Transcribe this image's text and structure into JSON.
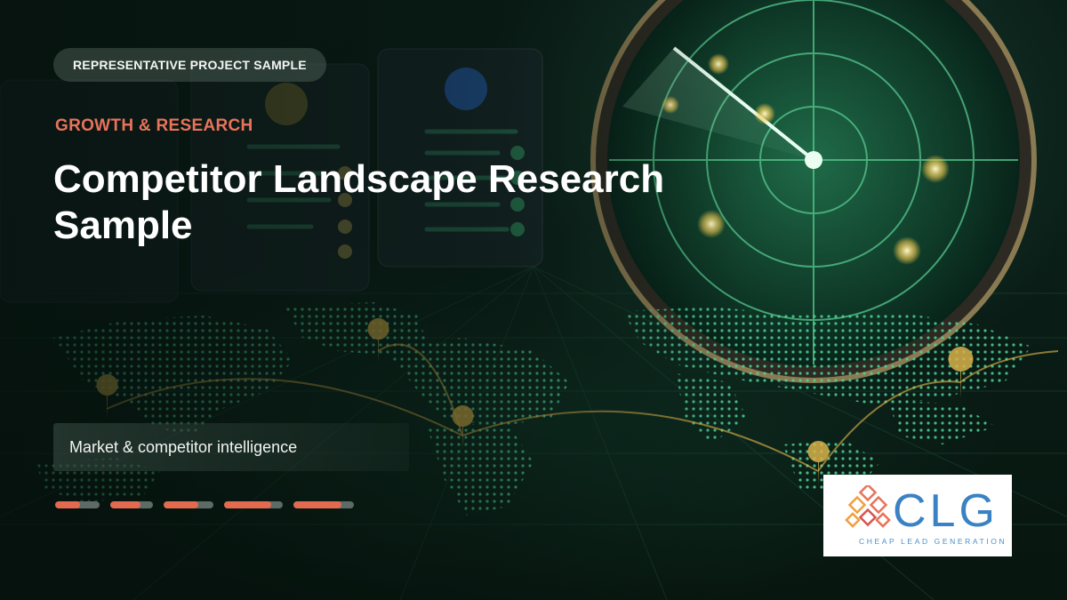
{
  "slide": {
    "tag": "REPRESENTATIVE PROJECT SAMPLE",
    "category": "GROWTH & RESEARCH",
    "title": "Competitor Landscape Research Sample",
    "subtitle": "Market & competitor intelligence"
  },
  "progress_indicators": [
    0.55,
    0.7,
    0.7,
    0.8,
    0.8
  ],
  "brand": {
    "logo_text": "CLG",
    "tagline": "CHEAP LEAD GENERATION"
  },
  "colors": {
    "accent": "#e36a4f",
    "background": "#0a1d17",
    "radar": "#3fbf7f",
    "logo_blue": "#3a82c4"
  },
  "icons": [
    "radar-icon",
    "map-pin-icon",
    "clg-logo-mark"
  ]
}
